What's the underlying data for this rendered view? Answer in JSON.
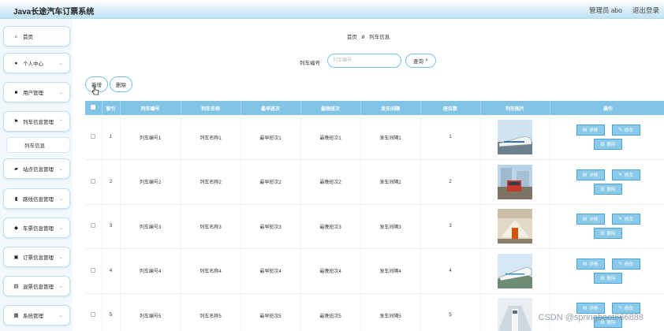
{
  "header": {
    "title": "Java长途汽车订票系统",
    "user": "管理员 abo",
    "logout": "退出登录"
  },
  "sidebar": {
    "items": [
      {
        "icon": "home-icon",
        "glyph": "⌂",
        "label": "首页",
        "chevron": false
      },
      {
        "icon": "person-icon",
        "glyph": "●",
        "label": "个人中心",
        "chevron": true
      },
      {
        "icon": "users-icon",
        "glyph": "■",
        "label": "用户管理",
        "chevron": true
      },
      {
        "icon": "flag-icon",
        "glyph": "⚑",
        "label": "列车信息管理",
        "chevron": true
      },
      {
        "icon": "briefcase-icon",
        "glyph": "▰",
        "label": "站点信息管理",
        "chevron": true
      },
      {
        "icon": "bar-chart-icon",
        "glyph": "▮",
        "label": "路线信息管理",
        "chevron": true
      },
      {
        "icon": "map-pin-icon",
        "glyph": "◆",
        "label": "车票信息管理",
        "chevron": true
      },
      {
        "icon": "ticket-icon",
        "glyph": "▣",
        "label": "订票信息管理",
        "chevron": true
      },
      {
        "icon": "refund-icon",
        "glyph": "▤",
        "label": "退票信息管理",
        "chevron": true
      },
      {
        "icon": "grid-icon",
        "glyph": "▦",
        "label": "系统管理",
        "chevron": true
      }
    ],
    "submenu": {
      "label": "列车信息"
    }
  },
  "breadcrumb": {
    "home": "首页",
    "separator": "//",
    "current": "列车信息"
  },
  "search": {
    "label": "列车编号",
    "placeholder": "列车编号",
    "button": "查询"
  },
  "actions": {
    "add": "新增",
    "delete": "删除"
  },
  "table": {
    "columns": [
      "索引",
      "列车编号",
      "列车名称",
      "最早班次",
      "最晚班次",
      "发车间隔",
      "座位数",
      "列车图片",
      "操作"
    ],
    "rows": [
      {
        "index": "1",
        "code": "列车编号1",
        "name": "列车名称1",
        "earliest": "最早班次1",
        "latest": "最晚班次1",
        "interval": "发车间隔1",
        "seats": "1"
      },
      {
        "index": "2",
        "code": "列车编号2",
        "name": "列车名称2",
        "earliest": "最早班次2",
        "latest": "最晚班次2",
        "interval": "发车间隔2",
        "seats": "2"
      },
      {
        "index": "3",
        "code": "列车编号3",
        "name": "列车名称3",
        "earliest": "最早班次3",
        "latest": "最晚班次3",
        "interval": "发车间隔3",
        "seats": "3"
      },
      {
        "index": "4",
        "code": "列车编号4",
        "name": "列车名称4",
        "earliest": "最早班次4",
        "latest": "最晚班次4",
        "interval": "发车间隔4",
        "seats": "4"
      },
      {
        "index": "5",
        "code": "列车编号5",
        "name": "列车名称5",
        "earliest": "最早班次5",
        "latest": "最晚班次5",
        "interval": "发车间隔5",
        "seats": "5"
      }
    ],
    "ops": {
      "detail": "详情",
      "edit": "修改",
      "delete": "删除"
    }
  },
  "watermark": "CSDN @springboot666888",
  "colors": {
    "accent": "#82c4e6",
    "button_fill": "#8bcaea",
    "button_border": "#4aa3d6"
  }
}
